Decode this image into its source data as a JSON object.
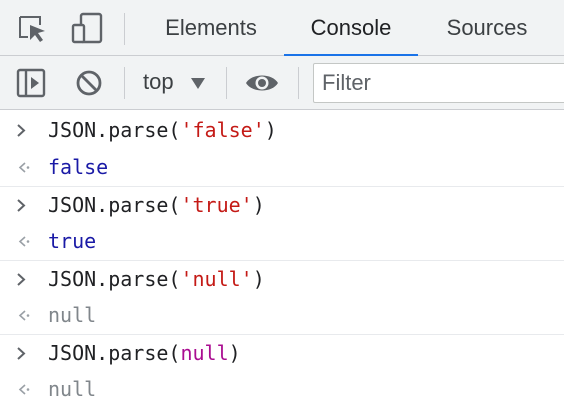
{
  "tabs": [
    {
      "label": "Elements",
      "active": false
    },
    {
      "label": "Console",
      "active": true
    },
    {
      "label": "Sources",
      "active": false
    }
  ],
  "toolbar": {
    "context": "top",
    "filter_placeholder": "Filter"
  },
  "console": {
    "entries": [
      {
        "kind": "input",
        "parts": [
          "JSON.parse(",
          "'false'",
          ")"
        ]
      },
      {
        "kind": "output",
        "text": "false",
        "style": "boolean"
      },
      {
        "kind": "input",
        "parts": [
          "JSON.parse(",
          "'true'",
          ")"
        ]
      },
      {
        "kind": "output",
        "text": "true",
        "style": "boolean"
      },
      {
        "kind": "input",
        "parts": [
          "JSON.parse(",
          "'null'",
          ")"
        ]
      },
      {
        "kind": "output",
        "text": "null",
        "style": "null"
      },
      {
        "kind": "input",
        "parts": [
          "JSON.parse(",
          "null",
          ")"
        ]
      },
      {
        "kind": "output",
        "text": "null",
        "style": "null"
      }
    ]
  },
  "colors": {
    "accent": "#1a73e8",
    "string": "#c41a16",
    "keyword": "#1a1aa6",
    "null_keyword": "#aa0d91",
    "muted": "#80868b"
  }
}
